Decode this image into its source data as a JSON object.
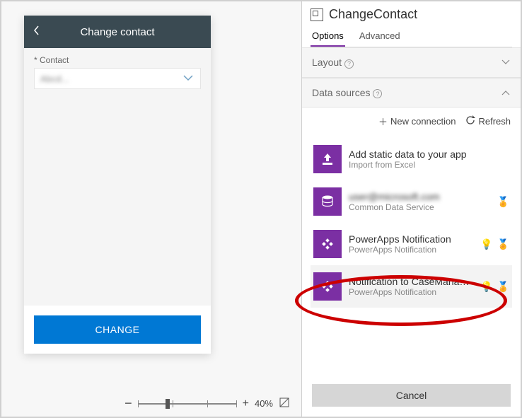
{
  "canvas": {
    "screen_title": "Change contact",
    "field_label": "* Contact",
    "dropdown_value": "Abcd...",
    "button_label": "CHANGE",
    "zoom_label": "40%"
  },
  "panel": {
    "title": "ChangeContact",
    "tabs": {
      "options": "Options",
      "advanced": "Advanced"
    },
    "sections": {
      "layout": "Layout",
      "data_sources": "Data sources"
    },
    "actions": {
      "new_connection": "New connection",
      "refresh": "Refresh"
    },
    "data_sources": [
      {
        "primary": "Add static data to your app",
        "secondary": "Import from Excel",
        "glyph": "upload"
      },
      {
        "primary": "user@microsoft.com",
        "secondary": "Common Data Service",
        "glyph": "db",
        "blurred": true
      },
      {
        "primary": "PowerApps Notification",
        "secondary": "PowerApps Notification",
        "glyph": "diamond"
      },
      {
        "primary": "Notification to CaseManageme...",
        "secondary": "PowerApps Notification",
        "glyph": "diamond",
        "highlighted": true
      }
    ],
    "cancel": "Cancel"
  }
}
